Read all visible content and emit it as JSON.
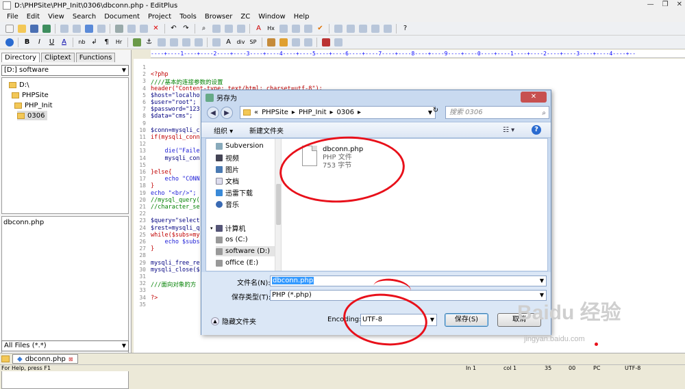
{
  "window": {
    "title": "D:\\PHPSite\\PHP_Init\\0306\\dbconn.php - EditPlus",
    "controls": [
      "—",
      "❐",
      "✕"
    ]
  },
  "menu": [
    "File",
    "Edit",
    "View",
    "Search",
    "Document",
    "Project",
    "Tools",
    "Browser",
    "ZC",
    "Window",
    "Help"
  ],
  "toolbar2_labels": {
    "b": "B",
    "i": "I",
    "u": "U",
    "a": "A",
    "nb": "nb",
    "div": "div",
    "sp": "SP"
  },
  "left_panel": {
    "tabs": [
      "Directory",
      "Cliptext",
      "Functions"
    ],
    "drive": "[D:] software",
    "tree": [
      "D:\\",
      "PHPSite",
      "PHP_Init",
      "0306"
    ],
    "files": [
      "dbconn.php"
    ],
    "filter": "All Files (*.*)"
  },
  "ruler": "----+----1----+----2----+----3----+----4----+----5----+----6----+----7----+----8----+----9----+----0----+----1----+----2----+----3----+----4----+--",
  "code_lines": [
    {
      "n": "1",
      "t": ""
    },
    {
      "n": "2",
      "t": "<?php"
    },
    {
      "n": "3",
      "t": "////基本的连接参数的设置"
    },
    {
      "n": "4",
      "t": "header(\"Content-type: text/html; charset=utf-8\");"
    },
    {
      "n": "5",
      "t": "$host=\"localho"
    },
    {
      "n": "6",
      "t": "$user=\"root\";"
    },
    {
      "n": "7",
      "t": "$password=\"123"
    },
    {
      "n": "8",
      "t": "$data=\"cms\";"
    },
    {
      "n": "9",
      "t": ""
    },
    {
      "n": "10",
      "t": "$conn=mysqli_c"
    },
    {
      "n": "11",
      "t": "if(mysqli_conn"
    },
    {
      "n": "12",
      "t": ""
    },
    {
      "n": "13",
      "t": "    die(\"Faile"
    },
    {
      "n": "14",
      "t": "    mysqli_con"
    },
    {
      "n": "15",
      "t": ""
    },
    {
      "n": "16",
      "t": "}else{"
    },
    {
      "n": "17",
      "t": "    echo \"CONN"
    },
    {
      "n": "18",
      "t": "}"
    },
    {
      "n": "19",
      "t": "echo \"<br/>\";"
    },
    {
      "n": "20",
      "t": "//mysql_query("
    },
    {
      "n": "21",
      "t": "//character_se"
    },
    {
      "n": "22",
      "t": ""
    },
    {
      "n": "23",
      "t": "$query=\"select"
    },
    {
      "n": "24",
      "t": "$rest=mysqli_q"
    },
    {
      "n": "25",
      "t": "while($subs=my"
    },
    {
      "n": "26",
      "t": "    echo $subs"
    },
    {
      "n": "27",
      "t": "}"
    },
    {
      "n": "28",
      "t": ""
    },
    {
      "n": "29",
      "t": "mysqli_free_re"
    },
    {
      "n": "30",
      "t": "mysqli_close($"
    },
    {
      "n": "31",
      "t": ""
    },
    {
      "n": "32",
      "t": "///面向对象的方"
    },
    {
      "n": "33",
      "t": ""
    },
    {
      "n": "34",
      "t": "?>"
    },
    {
      "n": "35",
      "t": ""
    }
  ],
  "doc_tab": "dbconn.php",
  "status": {
    "help": "For Help, press F1",
    "ln": "In 1",
    "col": "col 1",
    "n1": "35",
    "n2": "00",
    "mode": "PC",
    "enc": "UTF-8"
  },
  "dialog": {
    "title": "另存为",
    "path": [
      "«",
      "PHPSite",
      "PHP_Init",
      "0306"
    ],
    "search_placeholder": "搜索 0306",
    "organize": "组织 ▾",
    "new_folder": "新建文件夹",
    "nav": [
      "Subversion",
      "视频",
      "图片",
      "文档",
      "迅雷下载",
      "音乐",
      "计算机",
      "os (C:)",
      "software (D:)",
      "office (E:)"
    ],
    "file": {
      "name": "dbconn.php",
      "type": "PHP 文件",
      "size": "753 字节"
    },
    "filename_label": "文件名(N):",
    "filename_value": "dbconn.php",
    "filetype_label": "保存类型(T):",
    "filetype_value": "PHP (*.php)",
    "hide_folders": "隐藏文件夹",
    "encoding_label": "Encoding:",
    "encoding_value": "UTF-8",
    "save": "保存(S)",
    "cancel": "取消"
  },
  "watermark": {
    "logo": "Baidu 经验",
    "url": "jingyan.baidu.com"
  },
  "colors": {
    "annotation_red": "#e8101a",
    "selection": "#3399ff",
    "dialog_frame": "#c9daf0"
  }
}
